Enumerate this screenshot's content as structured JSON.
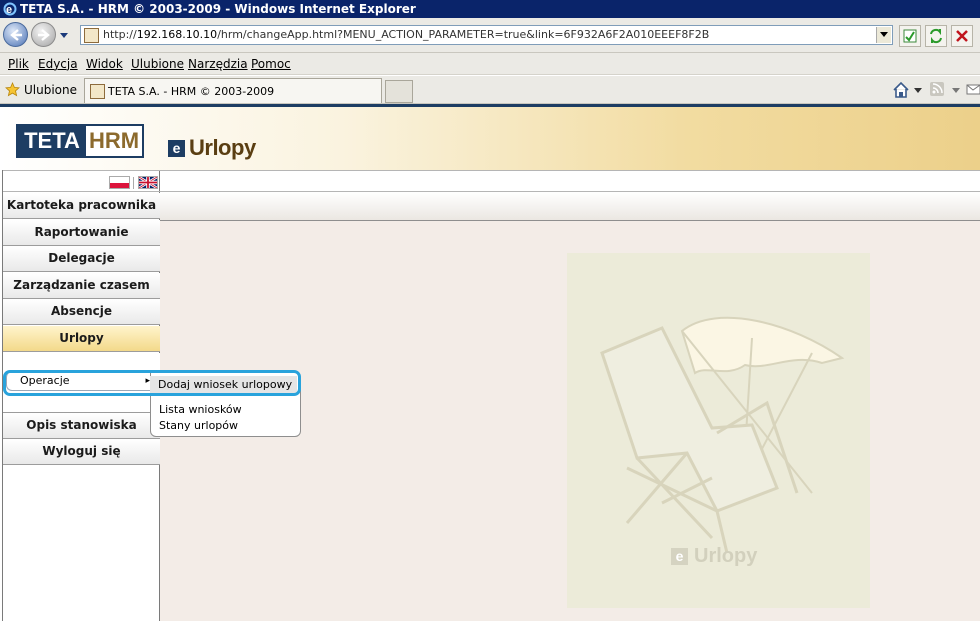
{
  "window": {
    "title": "TETA S.A. - HRM © 2003-2009 - Windows Internet Explorer"
  },
  "address_bar": {
    "url_prefix": "http://",
    "url_host": "192.168.10.10",
    "url_path": "/hrm/changeApp.html?MENU_ACTION_PARAMETER=true&link=6F932A6F2A010EEEF8F2B"
  },
  "menu": {
    "items": [
      "Plik",
      "Edycja",
      "Widok",
      "Ulubione",
      "Narzędzia",
      "Pomoc"
    ]
  },
  "favorites": {
    "label": "Ulubione",
    "tab_title": "TETA S.A. - HRM © 2003-2009"
  },
  "banner": {
    "logo_left": "TETA",
    "logo_right": "HRM",
    "app_badge": "e",
    "app_title": "Urlopy"
  },
  "nav": {
    "items": [
      {
        "label": "Kartoteka pracownika"
      },
      {
        "label": "Raportowanie"
      },
      {
        "label": "Delegacje"
      },
      {
        "label": "Zarządzanie czasem pracy"
      },
      {
        "label": "Absencje"
      },
      {
        "label": "Urlopy",
        "active": true
      },
      {
        "label": "Opis stanowiska"
      },
      {
        "label": "Wyloguj się"
      }
    ]
  },
  "context_menu": {
    "parent_label": "Operacje",
    "arrow": "▸",
    "items": [
      "Dodaj wniosek urlopowy",
      "Lista wniosków",
      "Stany urlopów"
    ],
    "highlighted_index": 0
  },
  "illustration": {
    "badge": "e",
    "caption": "Urlopy"
  },
  "colors": {
    "navy": "#1d3d63",
    "gold": "#f2dca1",
    "focus": "#29a3dc"
  }
}
